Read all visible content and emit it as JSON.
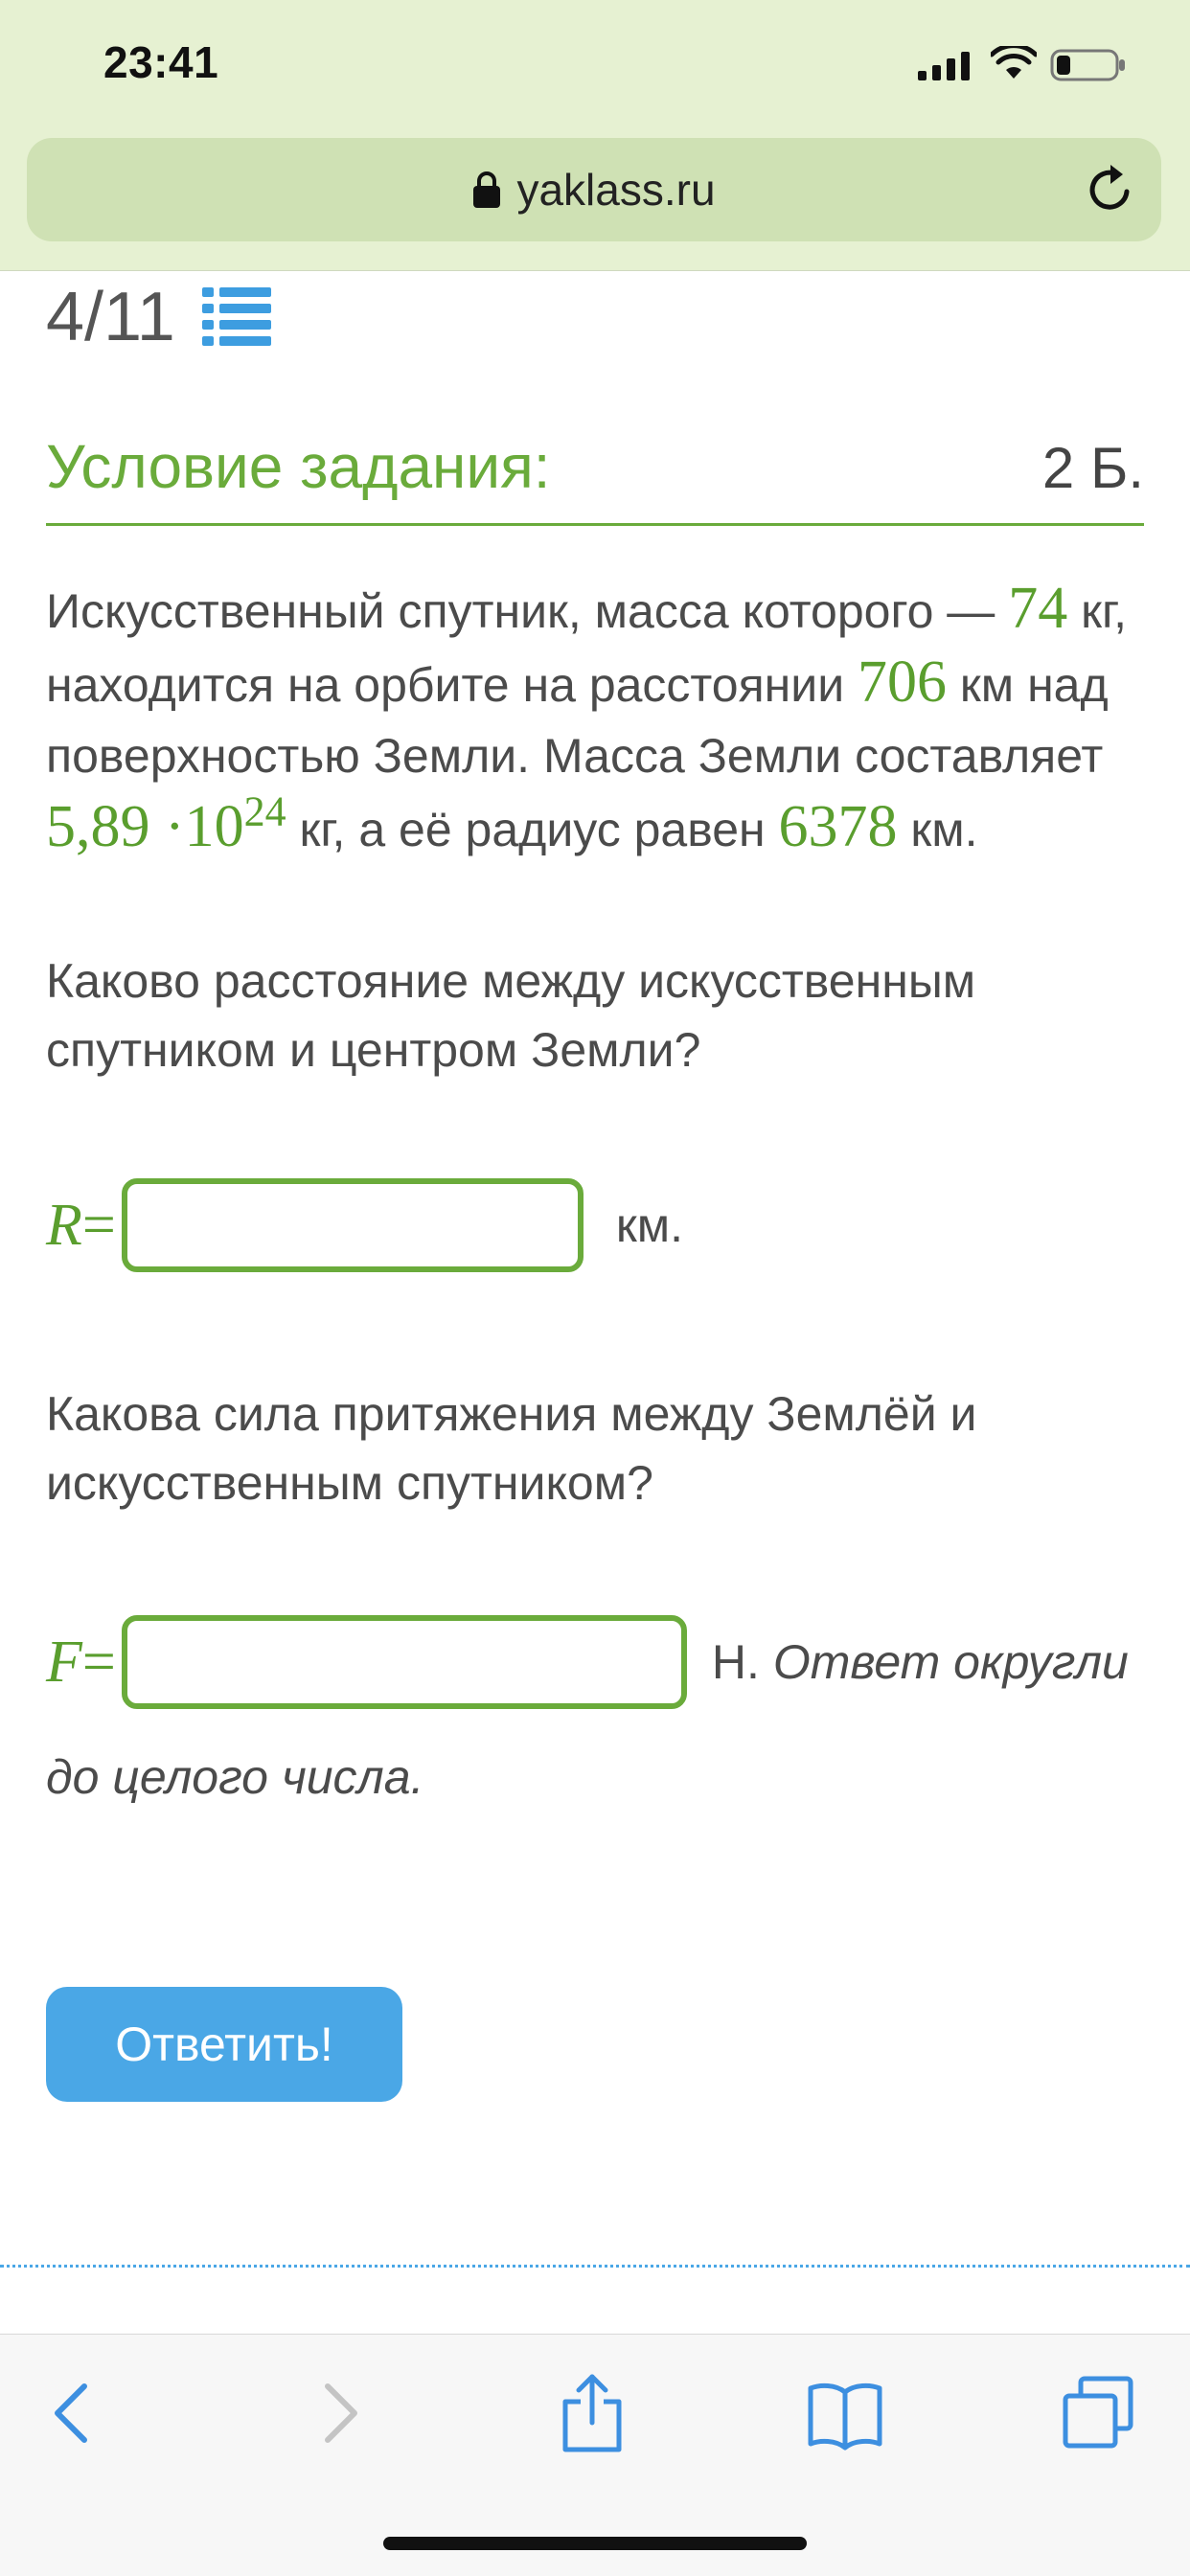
{
  "status_bar": {
    "time": "23:41"
  },
  "browser": {
    "url": "yaklass.ru"
  },
  "progress": {
    "text": "4/11"
  },
  "section": {
    "title": "Условие задания:",
    "points": "2 Б."
  },
  "task": {
    "p1": "Искусственный спутник, масса которого — ",
    "mass": "74",
    "p2": " кг, находится на орбите на расстоянии ",
    "distance": "706",
    "p3": " км над поверхностью Земли. Масса Земли составляет ",
    "earth_mass": "5,89",
    "dot": "·10",
    "exp": "24",
    "p4": " кг, а её радиус равен ",
    "radius": "6378",
    "p5": " км."
  },
  "q1": {
    "text": "Каково расстояние между искусственным спутником и центром Земли?",
    "var": "R",
    "eq": "=",
    "value": "",
    "unit": "км."
  },
  "q2": {
    "text": "Какова сила притяжения между Землёй и искусственным спутником?",
    "var": "F",
    "eq": "=",
    "value": "",
    "unit": "Н.",
    "hint_1": "Ответ округли",
    "hint_2": "до целого числа."
  },
  "submit": {
    "label": "Ответить!"
  },
  "colors": {
    "accent_green": "#6aab3b",
    "button_blue": "#4aa7e6",
    "chrome": "#e6f1d2"
  },
  "icons": [
    "lock-icon",
    "reload-icon",
    "list-icon",
    "back-icon",
    "forward-icon",
    "share-icon",
    "bookmarks-icon",
    "tabs-icon"
  ]
}
